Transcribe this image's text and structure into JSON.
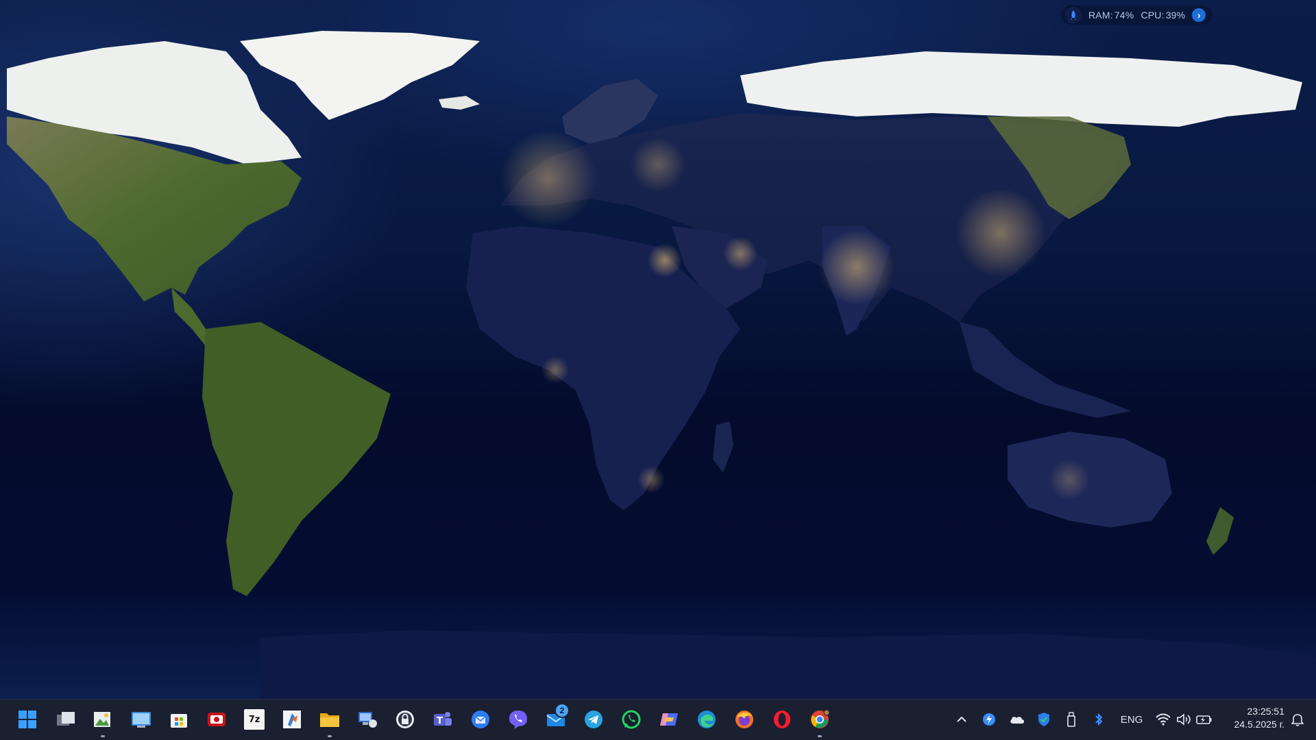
{
  "perf_widget": {
    "ram_label": "RAM:",
    "ram_value": "74%",
    "cpu_label": "CPU:",
    "cpu_value": "39%",
    "icons": [
      "rocket-icon",
      "arrow-right-icon"
    ]
  },
  "taskbar": {
    "apps": [
      {
        "id": "start",
        "icon": "windows-logo-icon",
        "glyph": "",
        "bg": "transparent"
      },
      {
        "id": "task-view",
        "icon": "task-view-icon",
        "glyph": "",
        "bg": "transparent"
      },
      {
        "id": "photo-app",
        "icon": "image-editor-icon",
        "glyph": "",
        "bg": "#3a6a3a",
        "running": true
      },
      {
        "id": "control-panel",
        "icon": "control-panel-icon",
        "glyph": "",
        "bg": "#3c8ad8"
      },
      {
        "id": "ms-store",
        "icon": "store-icon",
        "glyph": "",
        "bg": "#ffffff"
      },
      {
        "id": "screen-recorder",
        "icon": "recorder-icon",
        "glyph": "REC",
        "bg": "#c7151b"
      },
      {
        "id": "7zip",
        "icon": "archive-icon",
        "glyph": "7z",
        "bg": "#ffffff"
      },
      {
        "id": "dev-tool",
        "icon": "dev-tool-icon",
        "glyph": "",
        "bg": "#f2f4f7"
      },
      {
        "id": "file-explorer",
        "icon": "folder-icon",
        "glyph": "",
        "bg": "#f5c53c",
        "running": true
      },
      {
        "id": "remote-desktop",
        "icon": "remote-desktop-icon",
        "glyph": "",
        "bg": "#2f67c8"
      },
      {
        "id": "vpn",
        "icon": "lock-icon",
        "glyph": "",
        "bg": "#e8ecf2"
      },
      {
        "id": "teams",
        "icon": "teams-icon",
        "glyph": "T",
        "bg": "#5b5fc7"
      },
      {
        "id": "thunderbird",
        "icon": "mail-bird-icon",
        "glyph": "",
        "bg": "#2f7cf0"
      },
      {
        "id": "viber",
        "icon": "viber-icon",
        "glyph": "",
        "bg": "#7360f2"
      },
      {
        "id": "mail",
        "icon": "mail-icon",
        "glyph": "",
        "bg": "#1e88e5",
        "badge": "2"
      },
      {
        "id": "telegram",
        "icon": "telegram-icon",
        "glyph": "",
        "bg": "#2aa3df"
      },
      {
        "id": "whatsapp",
        "icon": "whatsapp-icon",
        "glyph": "",
        "bg": "#25d366"
      },
      {
        "id": "copilot",
        "icon": "copilot-icon",
        "glyph": "",
        "bg": "#6b7cf2"
      },
      {
        "id": "edge",
        "icon": "edge-icon",
        "glyph": "",
        "bg": "#1a8fd8"
      },
      {
        "id": "firefox",
        "icon": "firefox-icon",
        "glyph": "",
        "bg": "#f0702a"
      },
      {
        "id": "opera",
        "icon": "opera-icon",
        "glyph": "",
        "bg": "transparent"
      },
      {
        "id": "chrome",
        "icon": "chrome-icon",
        "glyph": "",
        "bg": "transparent",
        "running": true
      }
    ]
  },
  "tray": {
    "overflow_icon": "chevron-up-icon",
    "language": "ENG",
    "time": "23:25:51",
    "date": "24.5.2025 г."
  }
}
